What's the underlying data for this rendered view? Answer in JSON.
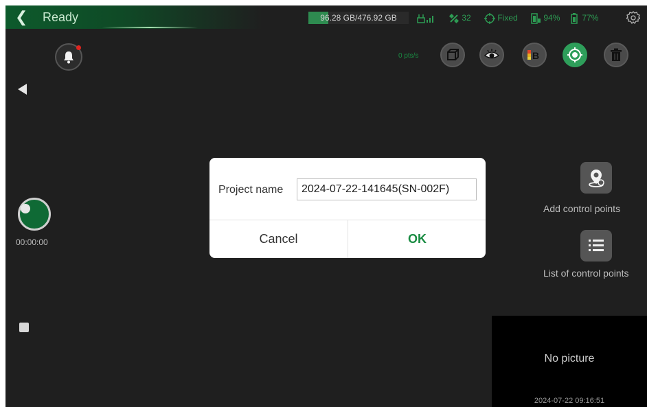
{
  "header": {
    "title": "Ready",
    "storage": {
      "text": "96.28 GB/476.92 GB",
      "used_fraction": 0.202
    },
    "satellites": "32",
    "fix_status": "Fixed",
    "device_battery": "94%",
    "controller_battery": "77%"
  },
  "toolbar": {
    "rate": "0 pts/s"
  },
  "left_panel": {
    "timer": "00:00:00"
  },
  "right_panel": {
    "add_control_points": "Add control points",
    "list_control_points": "List of control points"
  },
  "preview": {
    "no_picture": "No picture",
    "timestamp": "2024-07-22 09:16:51"
  },
  "dialog": {
    "label": "Project name",
    "project_name": "2024-07-22-141645(SN-002F)",
    "cancel": "Cancel",
    "ok": "OK"
  },
  "colors": {
    "accent": "#2e9e5a",
    "ok_text": "#1a8c43",
    "alert_dot": "#e0241f"
  },
  "icons": [
    "back-icon",
    "network-icon",
    "satellite-icon",
    "gnss-fix-icon",
    "device-battery-icon",
    "controller-battery-icon",
    "gear-icon",
    "bell-icon",
    "cube-icon",
    "eye-icon",
    "color-b-icon",
    "target-icon",
    "trash-icon",
    "location-pin-icon",
    "list-icon"
  ]
}
